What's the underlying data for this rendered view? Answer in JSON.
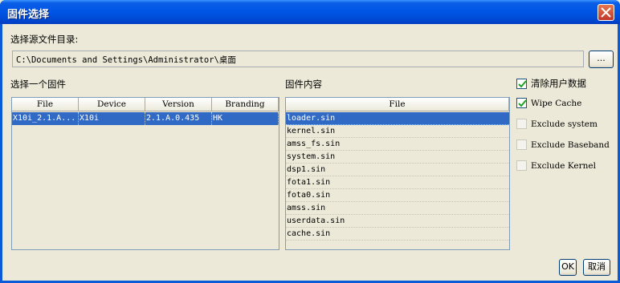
{
  "window": {
    "title": "固件选择"
  },
  "source_dir": {
    "label": "选择源文件目录:",
    "path": "C:\\Documents and Settings\\Administrator\\桌面",
    "browse_label": "..."
  },
  "firmware_list": {
    "label": "选择一个固件",
    "columns": [
      "File",
      "Device",
      "Version",
      "Branding"
    ],
    "rows": [
      {
        "file": "X10i_2.1.A...",
        "device": "X10i",
        "version": "2.1.A.0.435",
        "branding": "HK",
        "selected": true
      }
    ]
  },
  "firmware_content": {
    "label": "固件内容",
    "column": "File",
    "files": [
      "loader.sin",
      "kernel.sin",
      "amss_fs.sin",
      "system.sin",
      "dsp1.sin",
      "fota1.sin",
      "fota0.sin",
      "amss.sin",
      "userdata.sin",
      "cache.sin"
    ],
    "selected_index": 0
  },
  "options": [
    {
      "label": "清除用户数据",
      "checked": true,
      "enabled": true
    },
    {
      "label": "Wipe Cache",
      "checked": true,
      "enabled": true
    },
    {
      "label": "Exclude system",
      "checked": false,
      "enabled": false
    },
    {
      "label": "Exclude Baseband",
      "checked": false,
      "enabled": false
    },
    {
      "label": "Exclude Kernel",
      "checked": false,
      "enabled": false
    }
  ],
  "buttons": {
    "ok": "OK",
    "cancel": "取消"
  }
}
